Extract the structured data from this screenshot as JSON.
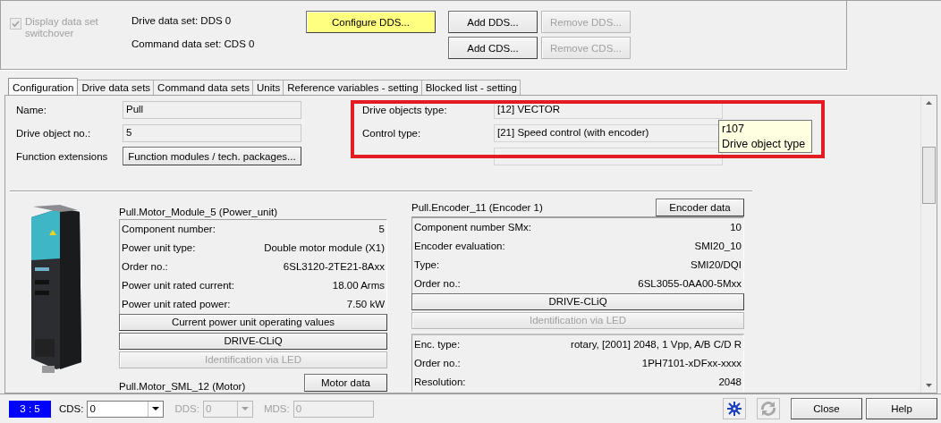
{
  "switchover": {
    "label": "Display data set switchover",
    "checked": true,
    "disabled": true
  },
  "data_sets": [
    "Drive data set: DDS 0",
    "Command data set: CDS 0"
  ],
  "top_buttons": [
    {
      "label": "Configure DDS...",
      "highlighted": true,
      "disabled": false
    },
    {
      "label": "Add DDS...",
      "highlighted": false,
      "disabled": false
    },
    {
      "label": "Remove DDS...",
      "highlighted": false,
      "disabled": true
    },
    {
      "label": "Add CDS...",
      "highlighted": false,
      "disabled": false
    },
    {
      "label": "Remove CDS...",
      "highlighted": false,
      "disabled": true
    }
  ],
  "tabs": [
    {
      "label": "Configuration",
      "selected": true
    },
    {
      "label": "Drive data sets",
      "selected": false
    },
    {
      "label": "Command data sets",
      "selected": false
    },
    {
      "label": "Units",
      "selected": false
    },
    {
      "label": "Reference variables - setting",
      "selected": false
    },
    {
      "label": "Blocked list - setting",
      "selected": false
    }
  ],
  "general_fields": [
    {
      "label": "Name:",
      "value": "Pull"
    },
    {
      "label": "Drive object no.:",
      "value": "5"
    }
  ],
  "function_extensions": {
    "label": "Function extensions",
    "button": "Function modules / tech. packages..."
  },
  "drive_object_fields": [
    {
      "label": "Drive objects type:",
      "value": "[12] VECTOR"
    },
    {
      "label": "Control type:",
      "value": "[21] Speed control (with encoder)"
    }
  ],
  "tooltip": {
    "lines": [
      "r107",
      "Drive object type"
    ]
  },
  "power_unit": {
    "title": "Pull.Motor_Module_5 (Power_unit)",
    "rows": [
      {
        "label": "Component number:",
        "value": "5"
      },
      {
        "label": "Power unit type:",
        "value": "Double motor module (X1)"
      },
      {
        "label": "Order no.:",
        "value": "6SL3120-2TE21-8Axx"
      },
      {
        "label": "Power unit rated current:",
        "value": "18.00 Arms"
      },
      {
        "label": "Power unit rated power:",
        "value": "7.50 kW"
      }
    ],
    "buttons": [
      {
        "label": "Current power unit operating values",
        "disabled": false
      },
      {
        "label": "DRIVE-CLiQ",
        "disabled": false
      },
      {
        "label": "Identification via LED",
        "disabled": true
      }
    ]
  },
  "motor": {
    "title": "Pull.Motor_SML_12 (Motor)",
    "button": "Motor data"
  },
  "encoder": {
    "title": "Pull.Encoder_11 (Encoder 1)",
    "button": "Encoder data",
    "rows": [
      {
        "label": "Component number SMx:",
        "value": "10"
      },
      {
        "label": "Encoder evaluation:",
        "value": "SMI20_10"
      },
      {
        "label": "Type:",
        "value": "SMI20/DQI"
      },
      {
        "label": "Order no.:",
        "value": "6SL3055-0AA00-5Mxx"
      }
    ],
    "buttons": [
      {
        "label": "DRIVE-CLiQ",
        "disabled": false
      },
      {
        "label": "Identification via LED",
        "disabled": true
      }
    ],
    "detail_rows": [
      {
        "label": "Enc. type:",
        "value": "rotary, [2001] 2048, 1 Vpp, A/B C/D R"
      },
      {
        "label": "Order no.:",
        "value": "1PH7101-xDFxx-xxxx"
      },
      {
        "label": "Resolution:",
        "value": "2048"
      }
    ]
  },
  "status_bar": {
    "indicator": "3 : 5",
    "selectors": [
      {
        "kind": "dropdown",
        "label": "CDS:",
        "value": "0",
        "disabled": false
      },
      {
        "kind": "dropdown",
        "label": "DDS:",
        "value": "0",
        "disabled": true
      },
      {
        "kind": "field",
        "label": "MDS:",
        "value": "0",
        "disabled": true
      }
    ],
    "tools": [
      {
        "kind": "network",
        "disabled": false
      },
      {
        "kind": "refresh",
        "disabled": true
      }
    ],
    "buttons": [
      "Close",
      "Help"
    ]
  }
}
